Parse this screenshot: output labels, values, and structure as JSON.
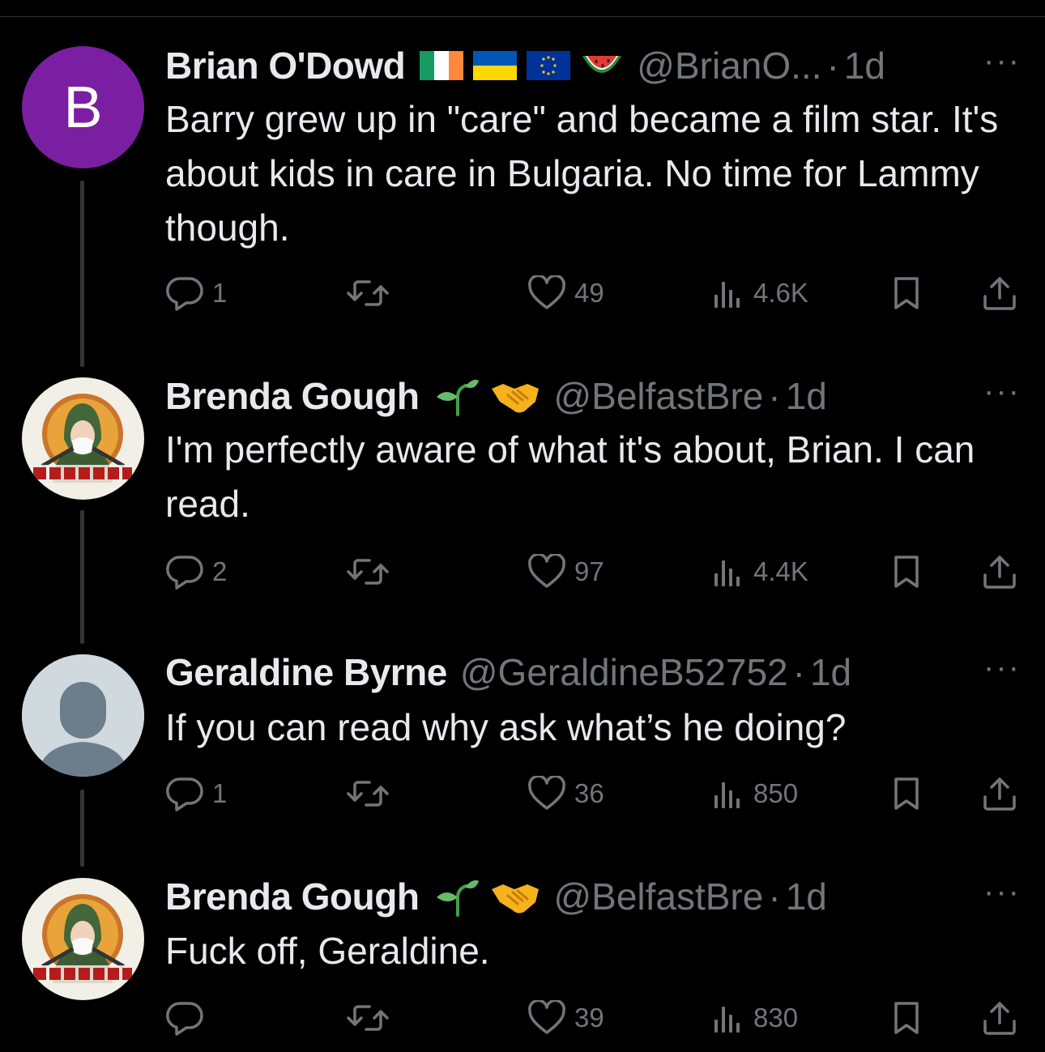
{
  "tweets": [
    {
      "avatar_letter": "B",
      "name": "Brian O'Dowd",
      "badges": [
        "ireland-flag-icon",
        "ukraine-flag-icon",
        "eu-flag-icon",
        "watermelon-icon"
      ],
      "handle": "@BrianO...",
      "time": "1d",
      "text": "Barry grew up in \"care\" and became a film star. It's about kids in care in Bulgaria. No time for Lammy though.",
      "replies": "1",
      "retweets": "",
      "likes": "49",
      "views": "4.6K"
    },
    {
      "name": "Brenda Gough",
      "badges": [
        "seedling-icon",
        "handshake-icon"
      ],
      "handle": "@BelfastBre",
      "time": "1d",
      "text": "I'm perfectly aware of what it's about, Brian. I can read.",
      "replies": "2",
      "retweets": "",
      "likes": "97",
      "views": "4.4K"
    },
    {
      "name": "Geraldine Byrne",
      "badges": [],
      "handle": "@GeraldineB52752",
      "time": "1d",
      "text": "If you can read why ask what’s he doing?",
      "replies": "1",
      "retweets": "",
      "likes": "36",
      "views": "850"
    },
    {
      "name": "Brenda Gough",
      "badges": [
        "seedling-icon",
        "handshake-icon"
      ],
      "handle": "@BelfastBre",
      "time": "1d",
      "text": "Fuck off, Geraldine.",
      "replies": "",
      "retweets": "",
      "likes": "39",
      "views": "830"
    }
  ],
  "separator": "·",
  "more_glyph": "···",
  "colors": {
    "background": "#000000",
    "text": "#e7e9ea",
    "muted": "#71767b",
    "avatar_purple": "#7b1fa2"
  }
}
